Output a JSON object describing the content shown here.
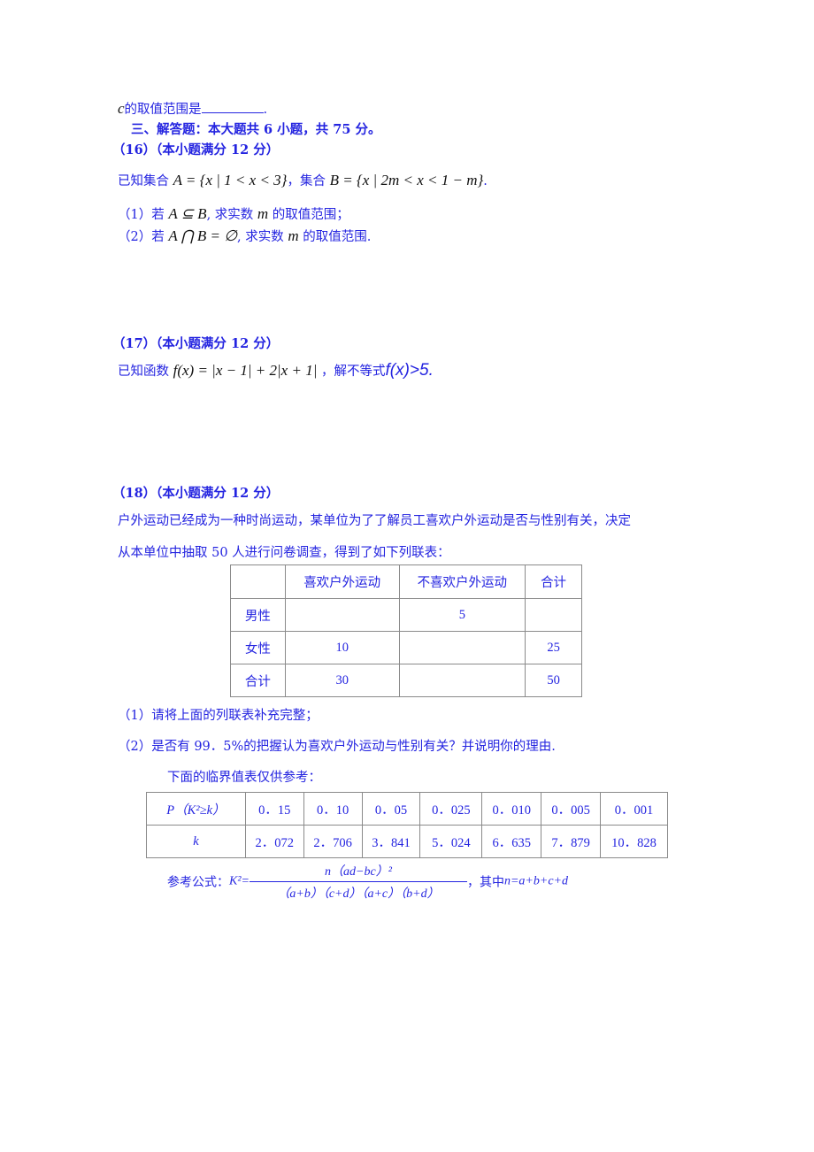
{
  "q15_tail": {
    "variable": "c",
    "text": "的取值范围是",
    "end": "."
  },
  "section3": {
    "heading": "三、解答题：本大题共 6 小题，共 75 分。"
  },
  "q16": {
    "header": "（16）（本小题满分 12 分）",
    "intro": "已知集合",
    "set_a": "A = {x | 1 < x < 3}",
    "mid": "，集合",
    "set_b": "B = {x | 2m < x < 1 − m}",
    "end": ".",
    "part1_prefix": "（1）若",
    "part1_math": "A ⊆ B",
    "part1_suffix": ", 求实数",
    "part1_var": "m",
    "part1_end": "的取值范围；",
    "part2_prefix": "（2）若",
    "part2_math": "A ⋂ B = ∅",
    "part2_suffix": ", 求实数",
    "part2_var": "m",
    "part2_end": "的取值范围."
  },
  "q17": {
    "header": "（17）（本小题满分 12 分）",
    "intro": "已知函数",
    "func": "f(x) = |x − 1| + 2|x + 1|",
    "mid": "，解不等式",
    "ineq": "f(x)>5."
  },
  "q18": {
    "header": "（18）（本小题满分 12 分）",
    "para_line1": "户外运动已经成为一种时尚运动，某单位为了了解员工喜欢户外运动是否与性别有关，决定",
    "para_line2": "从本单位中抽取 50 人进行问卷调查，得到了如下列联表：",
    "contingency_table": {
      "headers": [
        "",
        "喜欢户外运动",
        "不喜欢户外运动",
        "合计"
      ],
      "rows": [
        [
          "男性",
          "",
          "5",
          ""
        ],
        [
          "女性",
          "10",
          "",
          "25"
        ],
        [
          "合计",
          "30",
          "",
          "50"
        ]
      ]
    },
    "part1": "（1）请将上面的列联表补充完整；",
    "part2": "（2）是否有 99．5%的把握认为喜欢户外运动与性别有关？并说明你的理由.",
    "ref_note": "下面的临界值表仅供参考：",
    "critical_table": {
      "row1_label": "P（K²≥k）",
      "row2_label": "k",
      "p_values": [
        "0．15",
        "0．10",
        "0．05",
        "0．025",
        "0．010",
        "0．005",
        "0．001"
      ],
      "k_values": [
        "2．072",
        "2．706",
        "3．841",
        "5．024",
        "6．635",
        "7．879",
        "10．828"
      ]
    },
    "formula": {
      "label": "参考公式：",
      "lhs": "K²=",
      "numerator": "n（ad−bc）²",
      "denominator": "（a+b）（c+d）（a+c）（b+d）",
      "suffix_text": "，其中",
      "suffix_math": "n=a+b+c+d"
    }
  }
}
